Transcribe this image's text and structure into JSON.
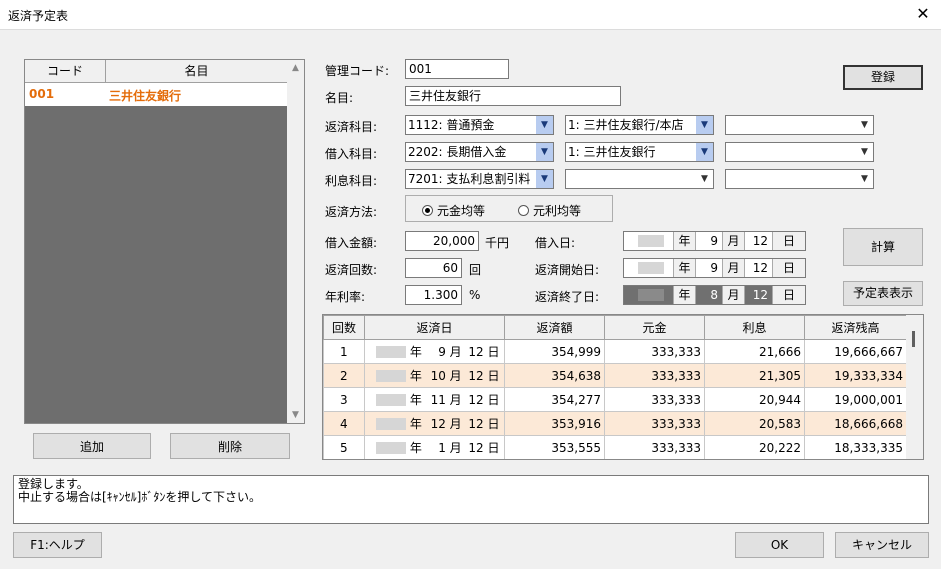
{
  "window": {
    "title": "返済予定表",
    "close_glyph": "✕"
  },
  "list": {
    "headers": {
      "code": "コード",
      "name": "名目"
    },
    "rows": [
      {
        "code": "001",
        "name": "三井住友銀行"
      }
    ],
    "add_button": "追加",
    "delete_button": "削除"
  },
  "form": {
    "mgmt_code_label": "管理コード:",
    "mgmt_code_value": "001",
    "name_label": "名目:",
    "name_value": "三井住友銀行",
    "repay_account_label": "返済科目:",
    "repay_account": [
      "1112: 普通預金",
      "1: 三井住友銀行/本店",
      ""
    ],
    "borrow_account_label": "借入科目:",
    "borrow_account": [
      "2202: 長期借入金",
      "1: 三井住友銀行",
      ""
    ],
    "interest_account_label": "利息科目:",
    "interest_account": [
      "7201: 支払利息割引料",
      "",
      ""
    ],
    "method_label": "返済方法:",
    "method_options": [
      "元金均等",
      "元利均等"
    ],
    "amount_label": "借入金額:",
    "amount_value": "20,000",
    "amount_unit": "千円",
    "count_label": "返済回数:",
    "count_value": "60",
    "count_unit": "回",
    "rate_label": "年利率:",
    "rate_value": "1.300",
    "rate_unit": "%",
    "borrow_date_label": "借入日:",
    "start_date_label": "返済開始日:",
    "end_date_label": "返済終了日:",
    "borrow_date": {
      "month": "9",
      "day": "12"
    },
    "start_date": {
      "month": "9",
      "day": "12"
    },
    "end_date": {
      "month": "8",
      "day": "12"
    },
    "year_unit": "年",
    "month_unit": "月",
    "day_unit": "日"
  },
  "buttons": {
    "register": "登録",
    "calculate": "計算",
    "show_schedule": "予定表表示",
    "help": "F1:ヘルプ",
    "ok": "OK",
    "cancel": "キャンセル"
  },
  "schedule": {
    "headers": [
      "回数",
      "返済日",
      "返済額",
      "元金",
      "利息",
      "返済残高"
    ],
    "rows": [
      {
        "n": "1",
        "month": "9",
        "day": "12",
        "amount": "354,999",
        "principal": "333,333",
        "interest": "21,666",
        "balance": "19,666,667"
      },
      {
        "n": "2",
        "month": "10",
        "day": "12",
        "amount": "354,638",
        "principal": "333,333",
        "interest": "21,305",
        "balance": "19,333,334"
      },
      {
        "n": "3",
        "month": "11",
        "day": "12",
        "amount": "354,277",
        "principal": "333,333",
        "interest": "20,944",
        "balance": "19,000,001"
      },
      {
        "n": "4",
        "month": "12",
        "day": "12",
        "amount": "353,916",
        "principal": "333,333",
        "interest": "20,583",
        "balance": "18,666,668"
      },
      {
        "n": "5",
        "month": "1",
        "day": "12",
        "amount": "353,555",
        "principal": "333,333",
        "interest": "20,222",
        "balance": "18,333,335"
      }
    ]
  },
  "message": {
    "line1": "登録します。",
    "line2": "中止する場合は[ｷｬﾝｾﾙ]ﾎﾞﾀﾝを押して下さい。"
  },
  "icons": {
    "dropdown": "chevron-down-icon",
    "scroll_up": "triangle-up-icon",
    "scroll_down": "triangle-down-icon"
  }
}
